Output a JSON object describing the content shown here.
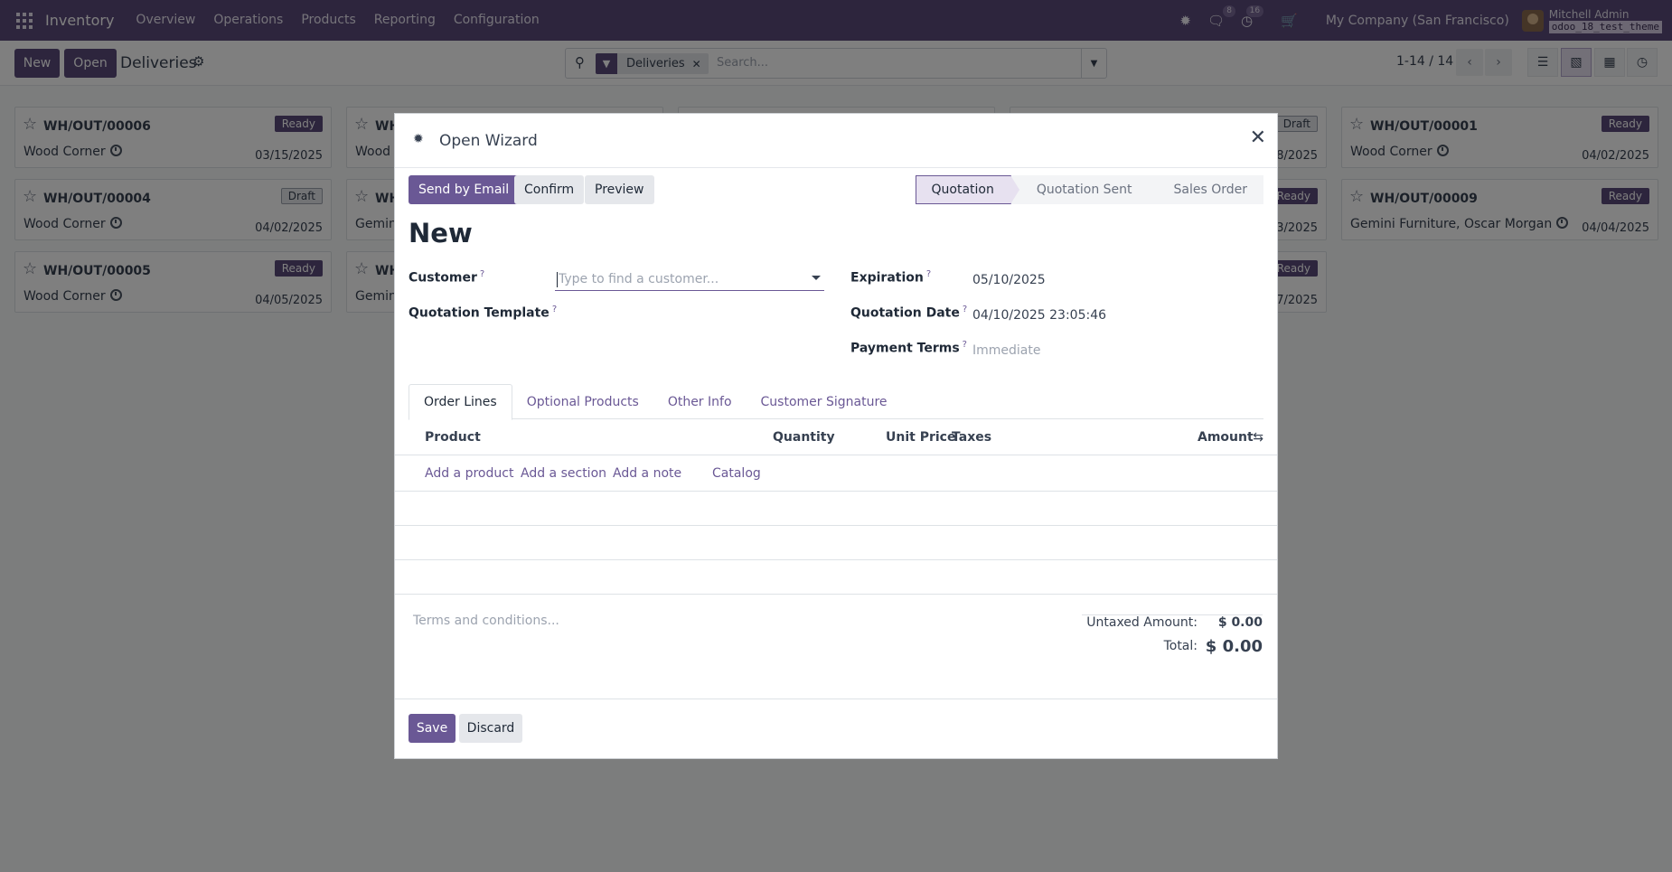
{
  "navbar": {
    "brand": "Inventory",
    "menu": [
      "Overview",
      "Operations",
      "Products",
      "Reporting",
      "Configuration"
    ],
    "messages_count": "8",
    "activities_count": "16",
    "company": "My Company (San Francisco)",
    "user_name": "Mitchell Admin",
    "database": "odoo_18_test_theme"
  },
  "control": {
    "new_label": "New",
    "open_label": "Open",
    "title": "Deliveries",
    "search_facet": "Deliveries",
    "search_placeholder": "Search...",
    "pager": "1-14 / 14"
  },
  "kanban": {
    "cards": [
      {
        "ref": "WH/OUT/00006",
        "status": "Ready",
        "partner": "Wood Corner",
        "date": "03/15/2025"
      },
      {
        "ref": "WH/OUT/00004",
        "status": "Draft",
        "partner": "Wood Corner",
        "date": "04/02/2025"
      },
      {
        "ref": "WH/OUT/00005",
        "status": "Ready",
        "partner": "Wood Corner",
        "date": "04/05/2025"
      },
      {
        "ref": "WH",
        "status": "",
        "partner": "Wood C",
        "date": ""
      },
      {
        "ref": "WH",
        "status": "",
        "partner": "Gemini",
        "date": ""
      },
      {
        "ref": "WH",
        "status": "",
        "partner": "Gemini",
        "date": ""
      },
      {
        "ref": "",
        "status": "Draft",
        "partner": "",
        "date": "8/2025"
      },
      {
        "ref": "",
        "status": "Ready",
        "partner": "",
        "date": "3/2025"
      },
      {
        "ref": "",
        "status": "Ready",
        "partner": "",
        "date": "7/2025"
      },
      {
        "ref": "WH/OUT/00001",
        "status": "Ready",
        "partner": "Wood Corner",
        "date": "04/02/2025"
      },
      {
        "ref": "WH/OUT/00009",
        "status": "Ready",
        "partner": "Gemini Furniture, Oscar Morgan",
        "date": "04/04/2025"
      }
    ]
  },
  "modal": {
    "title": "Open Wizard",
    "actions": {
      "send": "Send by Email",
      "confirm": "Confirm",
      "preview": "Preview"
    },
    "statusbar": [
      "Quotation",
      "Quotation Sent",
      "Sales Order"
    ],
    "record_name": "New",
    "fields": {
      "customer_label": "Customer",
      "customer_placeholder": "Type to find a customer...",
      "template_label": "Quotation Template",
      "expiration_label": "Expiration",
      "expiration_value": "05/10/2025",
      "qdate_label": "Quotation Date",
      "qdate_value": "04/10/2025 23:05:46",
      "terms_label": "Payment Terms",
      "terms_placeholder": "Immediate",
      "help": "?"
    },
    "tabs": [
      "Order Lines",
      "Optional Products",
      "Other Info",
      "Customer Signature"
    ],
    "columns": {
      "product": "Product",
      "quantity": "Quantity",
      "unit_price": "Unit Price",
      "taxes": "Taxes",
      "amount": "Amount"
    },
    "add_links": {
      "product": "Add a product",
      "section": "Add a section",
      "note": "Add a note",
      "catalog": "Catalog"
    },
    "terms_placeholder": "Terms and conditions...",
    "totals": {
      "untaxed_label": "Untaxed Amount:",
      "untaxed_value": "$ 0.00",
      "total_label": "Total:",
      "total_value": "$ 0.00"
    },
    "footer": {
      "save": "Save",
      "discard": "Discard"
    }
  }
}
